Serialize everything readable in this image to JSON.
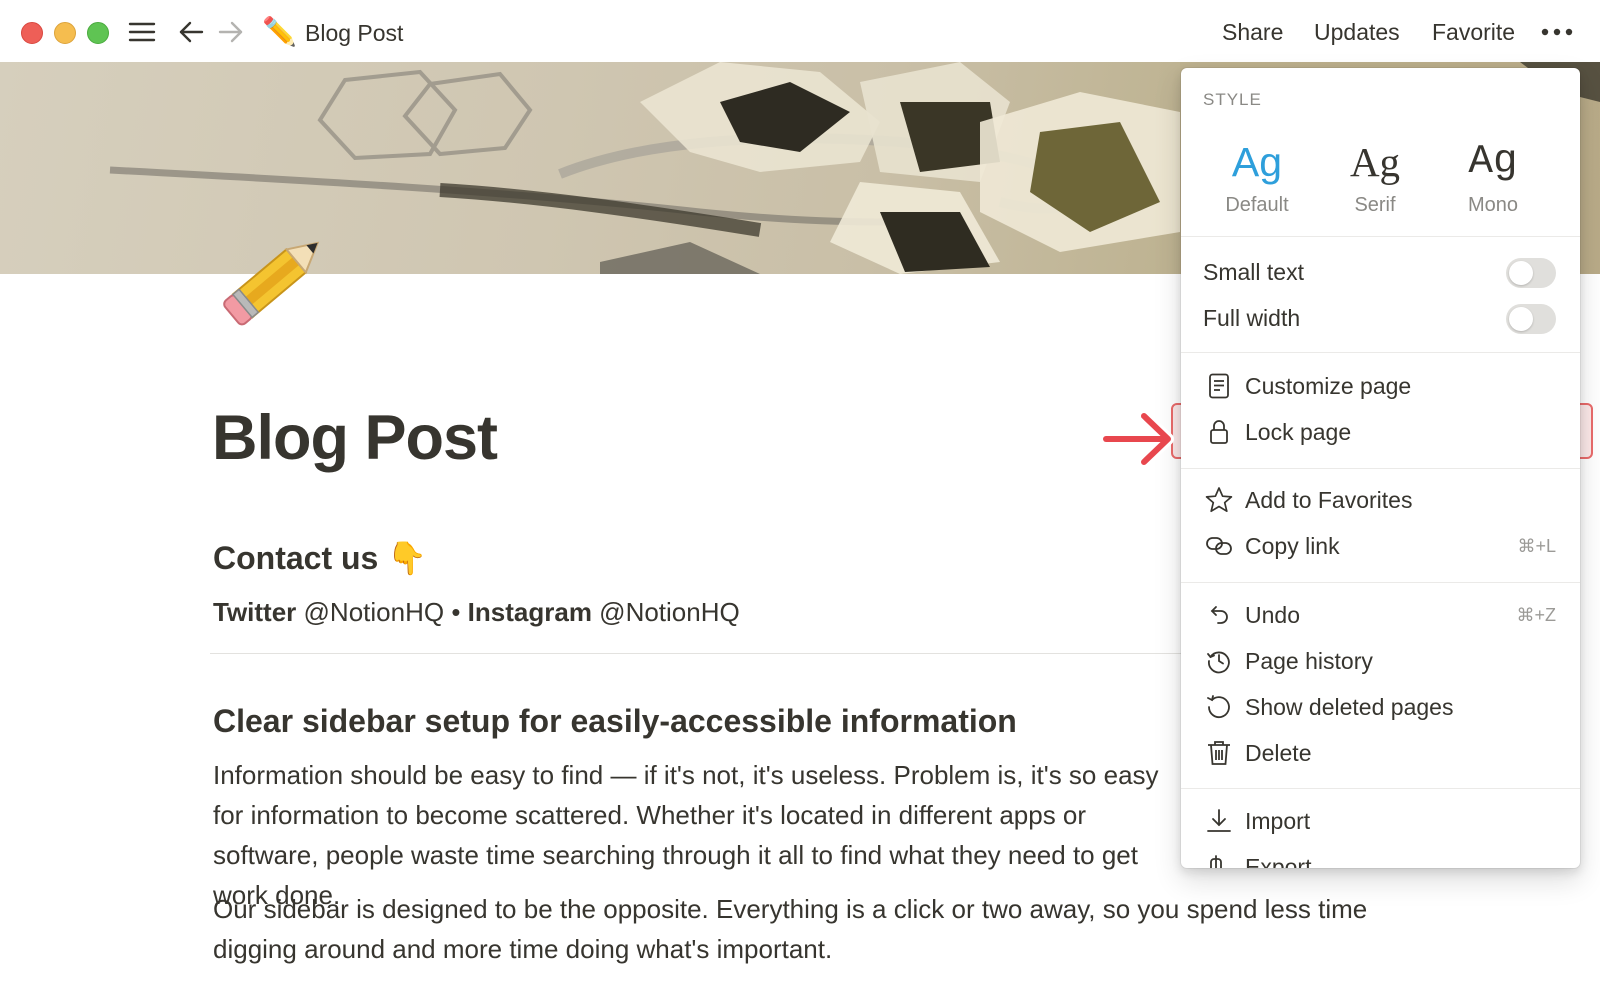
{
  "topbar": {
    "page_emoji": "✏️",
    "breadcrumb_title": "Blog Post",
    "share_label": "Share",
    "updates_label": "Updates",
    "favorite_label": "Favorite"
  },
  "page": {
    "icon": "pencil-icon",
    "title": "Blog Post",
    "contact_heading": "Contact us 👇",
    "contact": {
      "twitter_label": "Twitter",
      "twitter_handle": "@NotionHQ",
      "separator": "•",
      "instagram_label": "Instagram",
      "instagram_handle": "@NotionHQ"
    },
    "section_heading": "Clear sidebar setup for easily-accessible information",
    "paragraph_1": "Information should be easy to find — if it's not, it's useless. Problem is, it's so easy for information to become scattered. Whether it's located in different apps or software, people waste time searching through it all to find what they need to get work done.",
    "paragraph_2": "Our sidebar is designed to be the opposite. Everything is a click or two away, so you spend less time digging around and more time doing what's important."
  },
  "menu": {
    "style_label": "STYLE",
    "fonts": [
      {
        "sample": "Ag",
        "name": "Default",
        "selected": true
      },
      {
        "sample": "Ag",
        "name": "Serif",
        "selected": false
      },
      {
        "sample": "Ag",
        "name": "Mono",
        "selected": false
      }
    ],
    "small_text": {
      "label": "Small text",
      "on": false
    },
    "full_width": {
      "label": "Full width",
      "on": false
    },
    "items": {
      "customize": {
        "label": "Customize page",
        "icon": "document-icon"
      },
      "lock": {
        "label": "Lock page",
        "icon": "lock-icon",
        "highlighted": true
      },
      "favorites": {
        "label": "Add to Favorites",
        "icon": "star-icon"
      },
      "copy_link": {
        "label": "Copy link",
        "icon": "link-icon",
        "shortcut": "⌘+L"
      },
      "undo": {
        "label": "Undo",
        "icon": "undo-icon",
        "shortcut": "⌘+Z"
      },
      "history": {
        "label": "Page history",
        "icon": "history-icon"
      },
      "deleted": {
        "label": "Show deleted pages",
        "icon": "restore-icon"
      },
      "delete": {
        "label": "Delete",
        "icon": "trash-icon"
      },
      "import": {
        "label": "Import",
        "icon": "import-icon"
      },
      "export": {
        "label": "Export",
        "icon": "export-icon"
      }
    }
  },
  "colors": {
    "accent_blue": "#2e9fdb",
    "highlight_red": "#ea6b6b",
    "text": "#37352f",
    "muted": "#8a8985"
  }
}
